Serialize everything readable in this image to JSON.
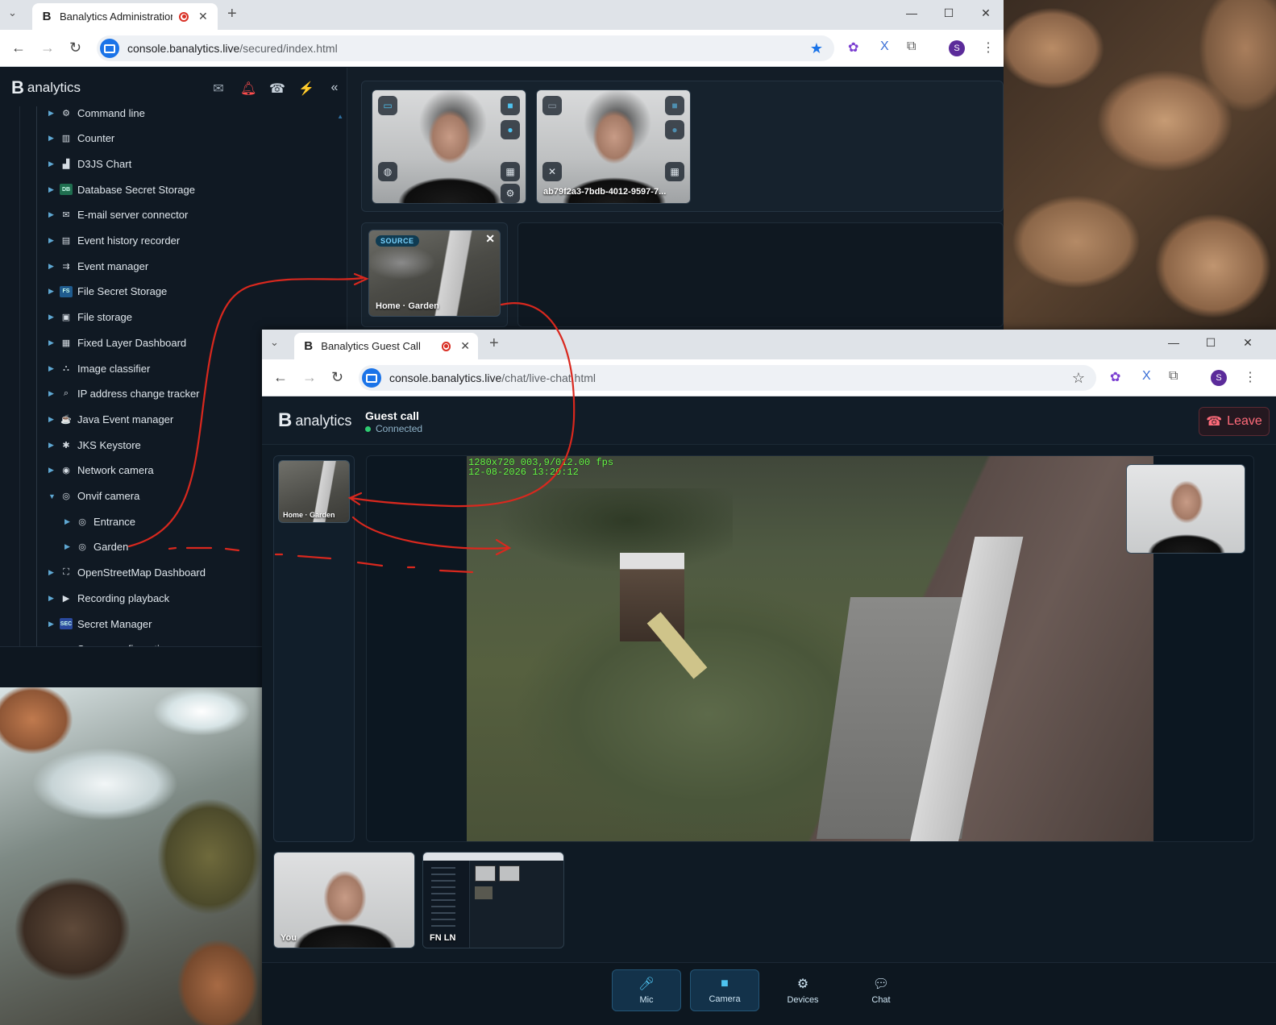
{
  "window1": {
    "tab_title": "Banalytics Administration C",
    "url_domain": "console.banalytics.live",
    "url_path": "/secured/index.html",
    "brand": "analytics",
    "tree": [
      {
        "label": "Command line",
        "icon": "command-icon",
        "y": 0
      },
      {
        "label": "Counter",
        "icon": "counter-icon"
      },
      {
        "label": "D3JS Chart",
        "icon": "chart-icon"
      },
      {
        "label": "Database Secret Storage",
        "icon": "db-badge-icon",
        "badge": "DB"
      },
      {
        "label": "E-mail server connector",
        "icon": "email-connector-icon"
      },
      {
        "label": "Event history recorder",
        "icon": "history-icon"
      },
      {
        "label": "Event manager",
        "icon": "event-manager-icon"
      },
      {
        "label": "File Secret Storage",
        "icon": "fs-badge-icon",
        "badge": "FS"
      },
      {
        "label": "File storage",
        "icon": "file-storage-icon"
      },
      {
        "label": "Fixed Layer Dashboard",
        "icon": "grid-icon"
      },
      {
        "label": "Image classifier",
        "icon": "classifier-icon"
      },
      {
        "label": "IP address change tracker",
        "icon": "search-icon"
      },
      {
        "label": "Java Event manager",
        "icon": "java-icon"
      },
      {
        "label": "JKS Keystore",
        "icon": "keystore-icon"
      },
      {
        "label": "Network camera",
        "icon": "network-camera-icon"
      },
      {
        "label": "Onvif camera",
        "icon": "onvif-camera-icon",
        "expanded": true
      },
      {
        "label": "Entrance",
        "icon": "onvif-camera-icon",
        "child": true
      },
      {
        "label": "Garden",
        "icon": "onvif-camera-icon",
        "child": true
      },
      {
        "label": "OpenStreetMap Dashboard",
        "icon": "map-icon"
      },
      {
        "label": "Recording playback",
        "icon": "playback-icon"
      },
      {
        "label": "Secret Manager",
        "icon": "sec-badge-icon",
        "badge": "SEC"
      },
      {
        "label": "Server configuration",
        "icon": "server-icon"
      }
    ],
    "tiles": [
      {
        "label": ""
      },
      {
        "label": "ab79f2a3-7bdb-4012-9597-7..."
      }
    ],
    "source_badge": "SOURCE",
    "source_label": "Home · Garden"
  },
  "window2": {
    "tab_title": "Banalytics Guest Call",
    "url_domain": "console.banalytics.live",
    "url_path": "/chat/live-chat.html",
    "brand": "analytics",
    "call_title": "Guest call",
    "call_status": "Connected",
    "leave_label": "Leave",
    "left_thumb_label": "Home · Garden",
    "osd_line1": "1280x720 003,9/012.00 fps",
    "osd_line2": "12-08-2026 13:20:12",
    "participants": [
      {
        "label": "You"
      },
      {
        "label": "FN LN"
      }
    ],
    "controls": [
      {
        "label": "Mic",
        "icon": "mic-icon",
        "active": true
      },
      {
        "label": "Camera",
        "icon": "camera-icon",
        "active": true
      },
      {
        "label": "Devices",
        "icon": "gear-icon",
        "active": false
      },
      {
        "label": "Chat",
        "icon": "chat-icon",
        "active": false
      }
    ]
  },
  "profile_initial": "S",
  "colors": {
    "accent_blue": "#1a73e8",
    "leave_red": "#ff6b7a",
    "annotation_red": "#d9281e",
    "connected_green": "#2ecc71"
  }
}
